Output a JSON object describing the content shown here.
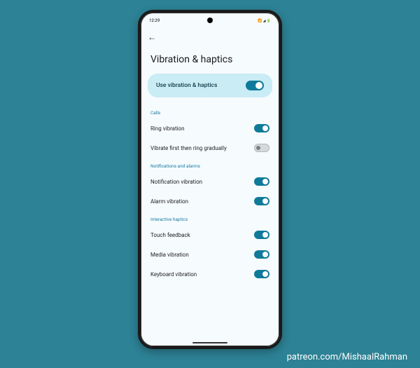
{
  "statusbar": {
    "time": "12:29",
    "icons_left": "🖼",
    "icons_right": "📶 ◢ 🔋"
  },
  "page": {
    "title": "Vibration & haptics"
  },
  "main": {
    "label": "Use vibration & haptics",
    "on": true
  },
  "sections": {
    "calls": {
      "header": "Calls",
      "ring": {
        "label": "Ring vibration",
        "on": true
      },
      "gradual": {
        "label": "Vibrate first then ring gradually",
        "on": false
      }
    },
    "notif": {
      "header": "Notifications and alarms",
      "notification": {
        "label": "Notification vibration",
        "on": true
      },
      "alarm": {
        "label": "Alarm vibration",
        "on": true
      }
    },
    "interactive": {
      "header": "Interactive haptics",
      "touch": {
        "label": "Touch feedback",
        "on": true
      },
      "media": {
        "label": "Media vibration",
        "on": true
      },
      "keyboard": {
        "label": "Keyboard vibration",
        "on": true
      }
    }
  },
  "credit": "patreon.com/MishaalRahman"
}
